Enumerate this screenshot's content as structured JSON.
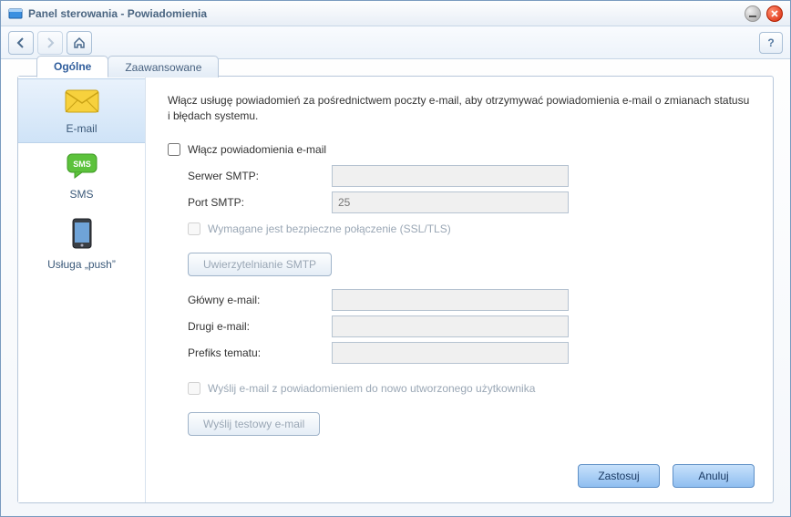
{
  "window": {
    "title": "Panel sterowania - Powiadomienia"
  },
  "tabs": {
    "general": "Ogólne",
    "advanced": "Zaawansowane"
  },
  "sidebar": {
    "email": "E-mail",
    "sms": "SMS",
    "push": "Usługa „push”"
  },
  "main": {
    "intro": "Włącz usługę powiadomień za pośrednictwem poczty e-mail, aby otrzymywać powiadomienia e-mail o zmianach statusu i błędach systemu.",
    "enable_label": "Włącz powiadomienia e-mail",
    "smtp_server_label": "Serwer SMTP:",
    "smtp_server_value": "",
    "smtp_port_label": "Port SMTP:",
    "smtp_port_placeholder": "25",
    "ssl_label": "Wymagane jest bezpieczne połączenie (SSL/TLS)",
    "auth_button": "Uwierzytelnianie SMTP",
    "primary_email_label": "Główny e-mail:",
    "primary_email_value": "",
    "second_email_label": "Drugi e-mail:",
    "second_email_value": "",
    "subject_prefix_label": "Prefiks tematu:",
    "subject_prefix_value": "",
    "send_new_user_label": "Wyślij e-mail z powiadomieniem do nowo utworzonego użytkownika",
    "test_button": "Wyślij testowy e-mail"
  },
  "footer": {
    "apply": "Zastosuj",
    "cancel": "Anuluj"
  },
  "help_glyph": "?"
}
